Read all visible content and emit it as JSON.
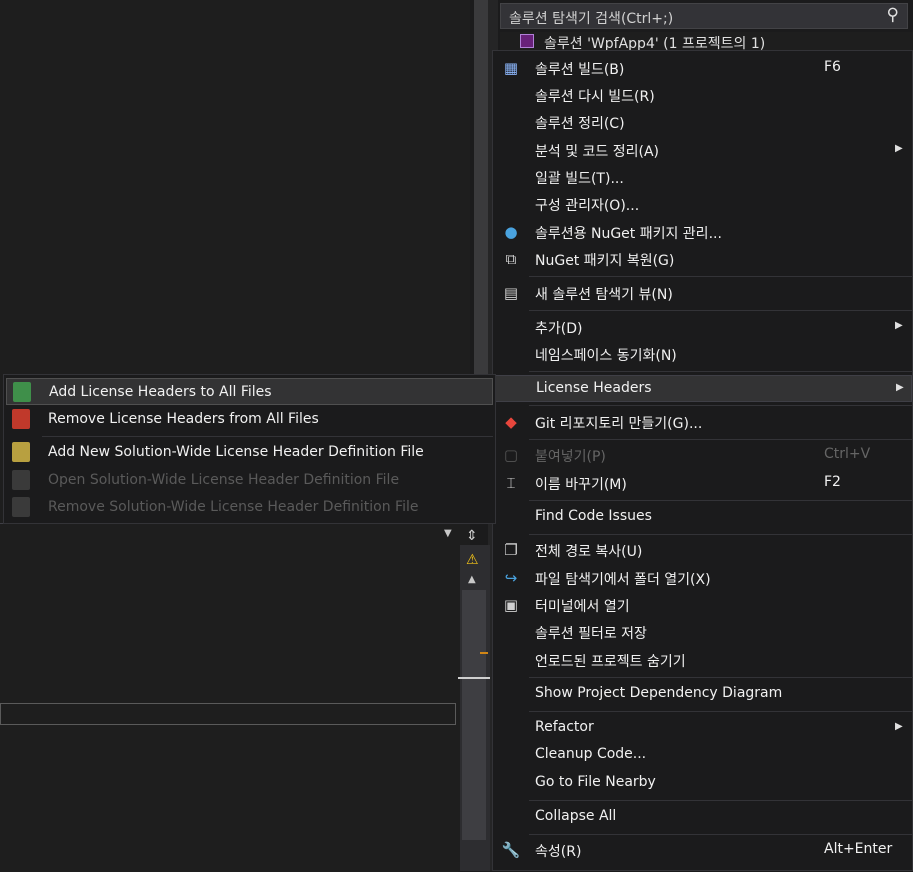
{
  "solution_explorer": {
    "search_placeholder": "솔루션 탐색기 검색(Ctrl+;)",
    "tree_root_label": "솔루션 'WpfApp4' (1 프로젝트의 1)"
  },
  "context_menu": {
    "items": [
      {
        "label": "솔루션 빌드(B)",
        "shortcut": "F6",
        "icon": "build-icon"
      },
      {
        "label": "솔루션 다시 빌드(R)"
      },
      {
        "label": "솔루션 정리(C)"
      },
      {
        "label": "분석 및 코드 정리(A)",
        "submenu": true
      },
      {
        "label": "일괄 빌드(T)..."
      },
      {
        "label": "구성 관리자(O)..."
      },
      {
        "label": "솔루션용 NuGet 패키지 관리...",
        "icon": "nuget-icon"
      },
      {
        "label": "NuGet 패키지 복원(G)",
        "icon": "restore-icon"
      },
      {
        "label": "새 솔루션 탐색기 뷰(N)",
        "icon": "new-view-icon"
      },
      {
        "label": "추가(D)",
        "submenu": true
      },
      {
        "label": "네임스페이스 동기화(N)"
      },
      {
        "label": "License Headers",
        "submenu": true,
        "highlighted": true
      },
      {
        "label": "Git 리포지토리 만들기(G)...",
        "icon": "git-icon"
      },
      {
        "label": "붙여넣기(P)",
        "shortcut": "Ctrl+V",
        "disabled": true,
        "icon": "paste-icon"
      },
      {
        "label": "이름 바꾸기(M)",
        "shortcut": "F2",
        "icon": "rename-icon"
      },
      {
        "label": "Find Code Issues"
      },
      {
        "label": "전체 경로 복사(U)",
        "icon": "copy-icon"
      },
      {
        "label": "파일 탐색기에서 폴더 열기(X)",
        "icon": "open-folder-icon"
      },
      {
        "label": "터미널에서 열기",
        "icon": "terminal-icon"
      },
      {
        "label": "솔루션 필터로 저장"
      },
      {
        "label": "언로드된 프로젝트 숨기기"
      },
      {
        "label": "Show Project Dependency Diagram"
      },
      {
        "label": "Refactor",
        "submenu": true
      },
      {
        "label": "Cleanup Code..."
      },
      {
        "label": "Go to File Nearby"
      },
      {
        "label": "Collapse All"
      },
      {
        "label": "속성(R)",
        "shortcut": "Alt+Enter",
        "icon": "wrench-icon"
      }
    ]
  },
  "license_submenu": {
    "items": [
      {
        "label": "Add License Headers to All Files",
        "highlighted": true,
        "icon": "add-headers-icon"
      },
      {
        "label": "Remove License Headers from All Files",
        "icon": "remove-headers-icon"
      },
      {
        "label": "Add New Solution-Wide License Header Definition File",
        "icon": "add-definition-icon"
      },
      {
        "label": "Open Solution-Wide License Header Definition File",
        "disabled": true,
        "icon": "open-definition-icon"
      },
      {
        "label": "Remove Solution-Wide License Header Definition File",
        "disabled": true,
        "icon": "remove-definition-icon"
      }
    ]
  },
  "colors": {
    "menu_bg": "#1b1b1c",
    "highlight_bg": "#333334",
    "disabled_text": "#656565",
    "warning": "#f5c518"
  }
}
